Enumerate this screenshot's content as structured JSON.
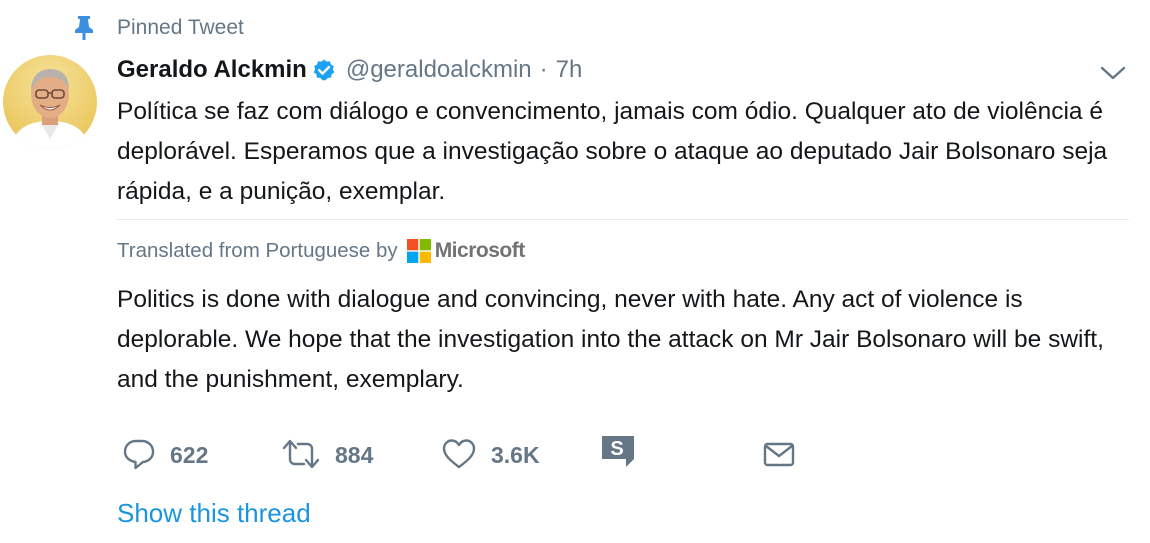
{
  "pinned": {
    "label": "Pinned Tweet",
    "icon": "pin-icon"
  },
  "tweet": {
    "author_name": "Geraldo Alckmin",
    "verified": true,
    "handle": "@geraldoalckmin",
    "separator": "·",
    "timestamp": "7h",
    "text": "Política se faz com diálogo e convencimento, jamais com ódio. Qualquer ato de violência é deplorável. Esperamos que a investigação sobre o ataque ao deputado Jair Bolsonaro seja rápida, e a punição, exemplar.",
    "translation": {
      "label": "Translated from Portuguese by",
      "provider": "Microsoft",
      "text": "Politics is done with dialogue and convincing, never with hate. Any act of violence is deplorable. We hope that the investigation into the attack on Mr Jair Bolsonaro will be swift, and the punishment, exemplary."
    },
    "actions": {
      "reply_count": "622",
      "retweet_count": "884",
      "like_count": "3.6K"
    },
    "show_thread_label": "Show this thread"
  },
  "colors": {
    "text_primary": "#14171a",
    "text_secondary": "#657786",
    "link_blue": "#1b95e0",
    "verified_blue": "#1da1f2",
    "pin_blue": "#1da1f2",
    "divider": "#e6ecf0"
  },
  "icons": {
    "pin": "pin-icon",
    "verified": "verified-badge-icon",
    "caret": "chevron-down-icon",
    "reply": "reply-bubble-icon",
    "retweet": "retweet-icon",
    "like": "heart-icon",
    "share_tool": "share-s-icon",
    "direct_message": "envelope-icon",
    "microsoft": "microsoft-logo-icon"
  }
}
